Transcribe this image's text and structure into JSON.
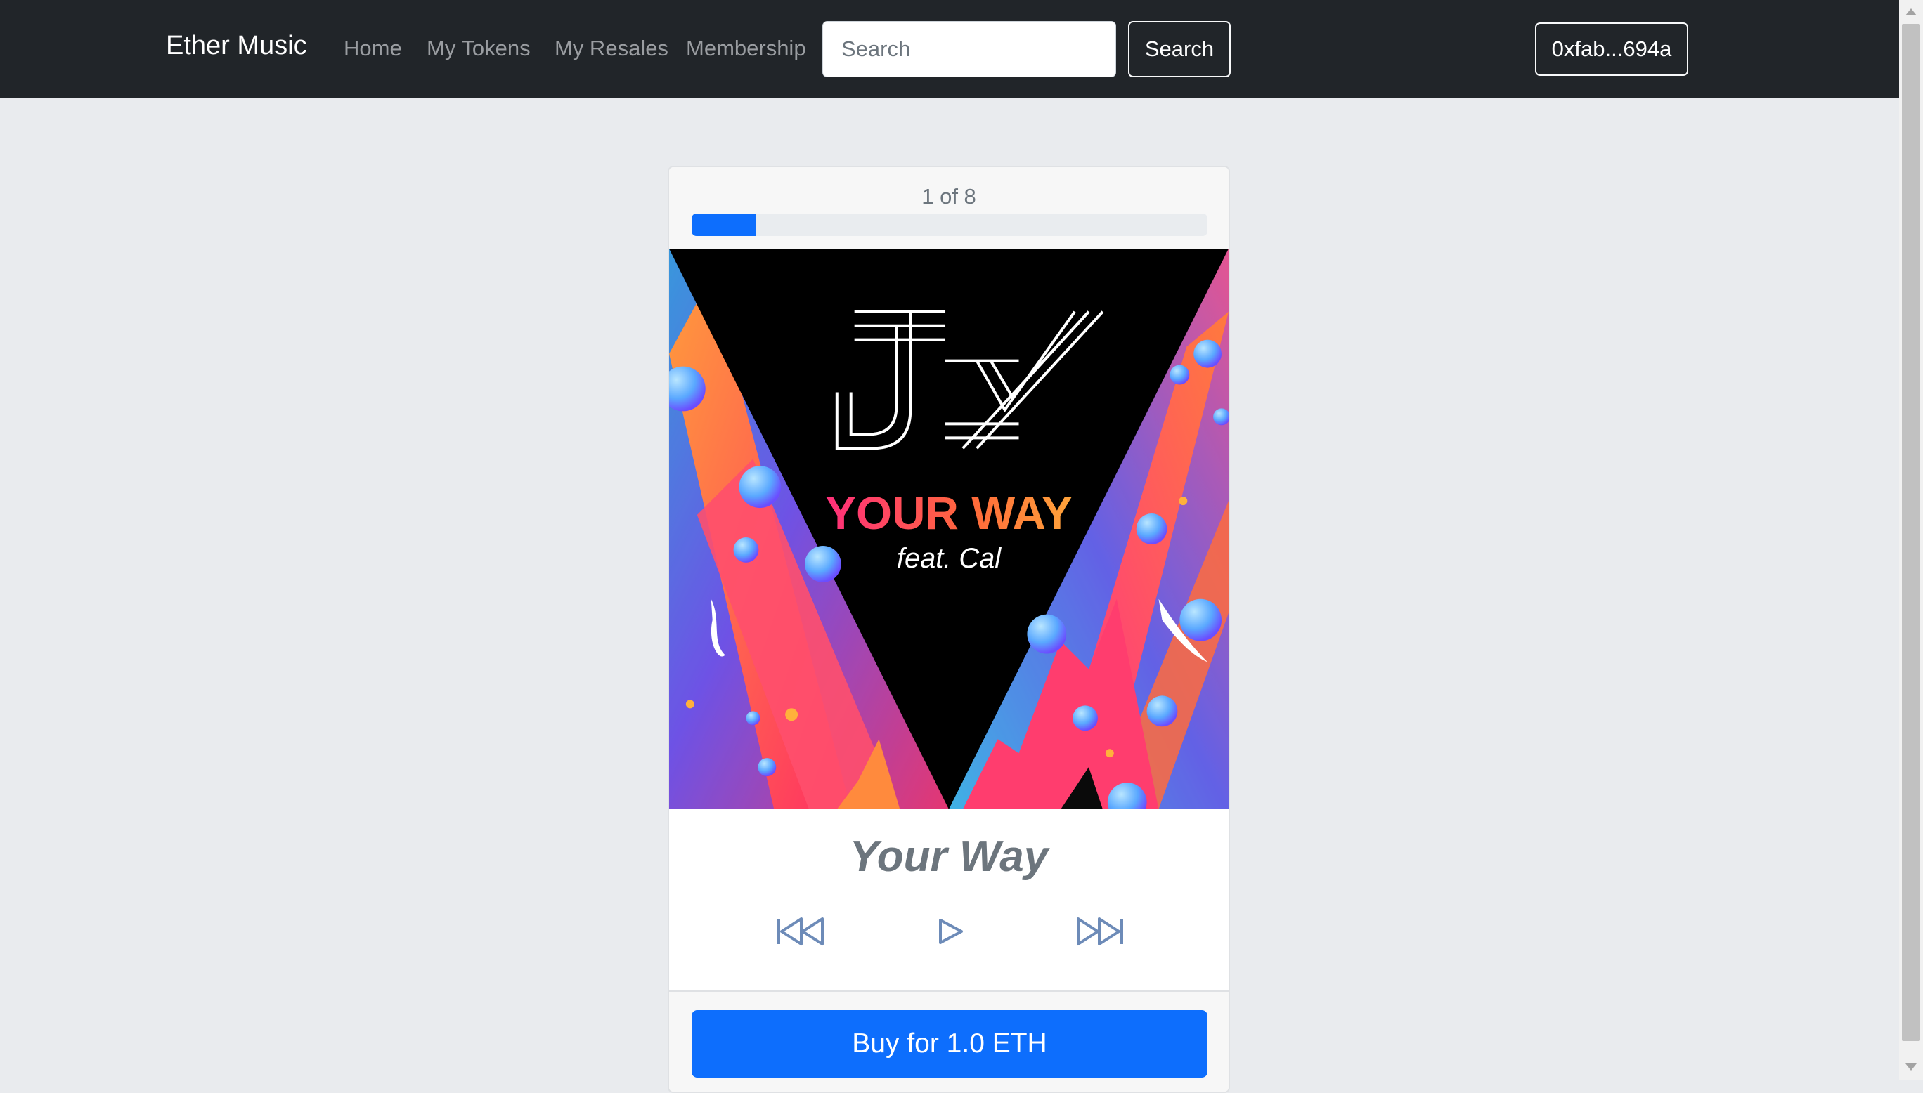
{
  "navbar": {
    "brand": "Ether Music",
    "links": [
      {
        "label": "Home"
      },
      {
        "label": "My Tokens"
      },
      {
        "label": "My Resales"
      },
      {
        "label": "Membership"
      }
    ],
    "search": {
      "placeholder": "Search",
      "value": "",
      "button_label": "Search"
    },
    "account_label": "0xfab...694a"
  },
  "player": {
    "counter_text": "1 of 8",
    "progress_fraction": 0.125,
    "progress_color": "#0d6efd",
    "cover": {
      "artist_logo": "JCY",
      "title": "YOUR WAY",
      "subtitle": "feat. Cal"
    },
    "song_title": "Your Way",
    "controls": [
      {
        "icon": "skip-backward-icon"
      },
      {
        "icon": "play-icon"
      },
      {
        "icon": "skip-forward-icon"
      }
    ],
    "buy_label": "Buy for 1.0 ETH"
  },
  "colors": {
    "navbar_bg": "#212529",
    "page_bg": "#e9ebee",
    "primary": "#0d6efd",
    "control_icon": "#6d8bb8"
  }
}
